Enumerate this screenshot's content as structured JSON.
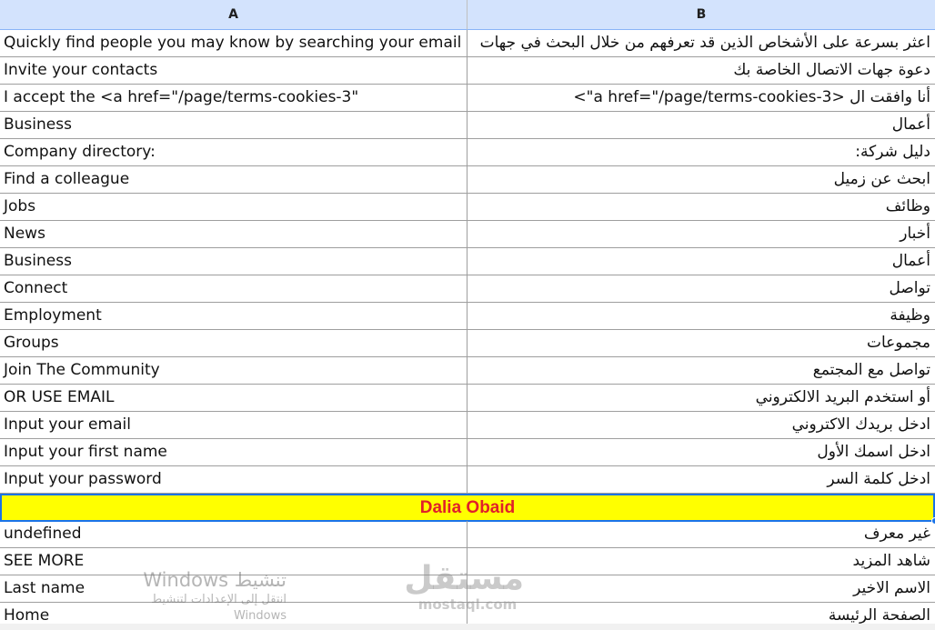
{
  "columns": {
    "a": "A",
    "b": "B"
  },
  "rows": [
    {
      "en": "Quickly find people you may know by searching your email",
      "ar": "اعثر بسرعة على الأشخاص الذين قد تعرفهم من خلال البحث في جهات"
    },
    {
      "en": "Invite your contacts",
      "ar": "دعوة جهات الاتصال الخاصة بك"
    },
    {
      "en": "I accept the <a href=\"/page/terms-cookies-3\"",
      "ar": "أنا وافقت ال <a href=\"/page/terms-cookies-3\">"
    },
    {
      "en": "Business",
      "ar": "أعمال"
    },
    {
      "en": "Company directory:",
      "ar": "دليل شركة:"
    },
    {
      "en": "Find a colleague",
      "ar": "ابحث عن زميل"
    },
    {
      "en": "Jobs",
      "ar": "وظائف"
    },
    {
      "en": "News",
      "ar": "أخبار"
    },
    {
      "en": "Business",
      "ar": "أعمال"
    },
    {
      "en": "Connect",
      "ar": "تواصل"
    },
    {
      "en": "Employment",
      "ar": "وظيفة"
    },
    {
      "en": "Groups",
      "ar": "مجموعات"
    },
    {
      "en": "Join The Community",
      "ar": "تواصل مع المجتمع"
    },
    {
      "en": "OR USE EMAIL",
      "ar": "أو استخدم البريد الالكتروني"
    },
    {
      "en": "Input your email",
      "ar": "ادخل بريدك الاكتروني"
    },
    {
      "en": "Input your first name",
      "ar": "ادخل اسمك الأول"
    },
    {
      "en": "Input your password",
      "ar": "ادخل كلمة السر"
    }
  ],
  "merged_row": {
    "text": "Dalia Obaid",
    "background": "#ffff00",
    "color": "#e0202a"
  },
  "rows_after": [
    {
      "en": "undefined",
      "ar": "غير معرف"
    },
    {
      "en": "SEE MORE",
      "ar": "شاهد المزيد"
    },
    {
      "en": "Last name",
      "ar": "الاسم الاخير"
    },
    {
      "en": "Home",
      "ar": "الصفحة الرئيسة"
    }
  ],
  "watermark": {
    "title": "تنشيط Windows",
    "subtitle": "انتقل إلى الإعدادات لتنشيط Windows"
  },
  "logo": {
    "main": "مستقل",
    "sub": "mostaql.com"
  },
  "colors": {
    "header_bg": "#d3e3fd",
    "selection": "#1a73e8"
  }
}
